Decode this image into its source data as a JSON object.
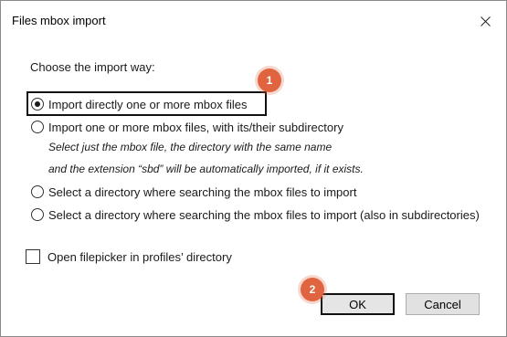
{
  "window": {
    "title": "Files mbox import",
    "close_icon": "close-icon"
  },
  "dialog": {
    "prompt": "Choose the import way:",
    "options": [
      {
        "label": "Import directly one or more mbox files",
        "checked": true
      },
      {
        "label": "Import one or more mbox files, with its/their subdirectory",
        "checked": false
      },
      {
        "label": "Select a directory where searching the mbox files to import",
        "checked": false
      },
      {
        "label": "Select a directory where searching the mbox files to import (also in subdirectories)",
        "checked": false
      }
    ],
    "note_line1": "Select just the mbox file, the directory with the same name",
    "note_line2": "and the extension “sbd” will be automatically imported, if it exists.",
    "checkbox_label": "Open filepicker in profiles’ directory",
    "checkbox_checked": false,
    "ok_label": "OK",
    "cancel_label": "Cancel"
  },
  "annotations": {
    "badge1": "1",
    "badge2": "2",
    "badge_color": "#e0643f"
  }
}
